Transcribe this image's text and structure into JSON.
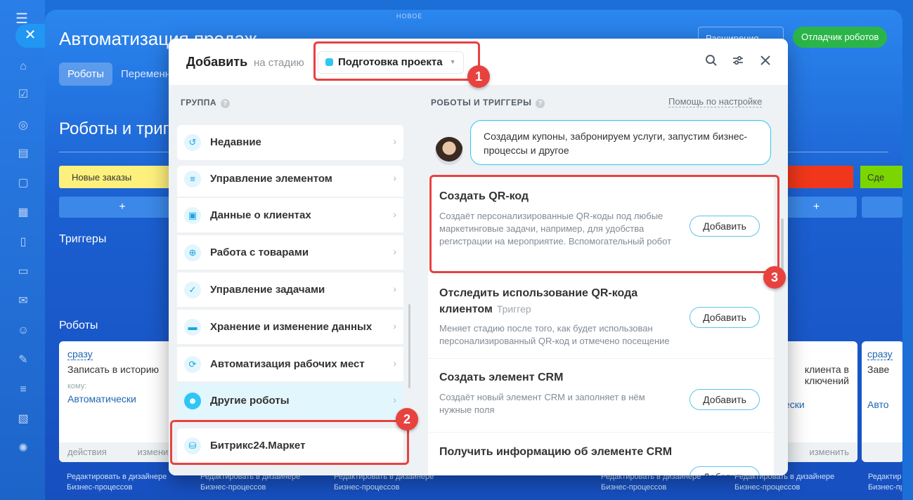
{
  "rail": {
    "icons": [
      "menu-icon",
      "close-icon",
      "home-icon",
      "check-icon",
      "palette-icon",
      "doc-icon",
      "chat-icon",
      "calendar-icon",
      "file-icon",
      "card-icon",
      "mail-icon",
      "users-icon",
      "pen-icon",
      "filter-icon",
      "gear-doc-icon",
      "settings-icon"
    ]
  },
  "background": {
    "top_label": "НОВОЕ",
    "title": "Автоматизация продаж",
    "tabs": [
      "Роботы",
      "Переменные"
    ],
    "extensions_button": "Расширения",
    "debug_button": "Отладчик роботов",
    "section_title": "Роботы и триггеры",
    "stage_new_orders": "Новые заказы",
    "stage_right": "Сде",
    "plus": "+",
    "triggers_label": "Триггеры",
    "robots_label": "Роботы",
    "card_left": {
      "when": "сразу",
      "title": "Записать в историю",
      "to_label": "кому:",
      "to_value": "Автоматически",
      "foot_left": "действия",
      "foot_right": "изменить"
    },
    "card_right": {
      "title_line1": "клиента в",
      "title_line2": "ключений",
      "value": "ески",
      "foot_right": "изменить"
    },
    "card_far": {
      "when": "сразу",
      "title": "Заве",
      "value": "Авто"
    },
    "edit_link_line1": "Редактировать в дизайнере",
    "edit_link_line2": "Бизнес-процессов"
  },
  "modal": {
    "title": "Добавить",
    "stage_label": "на стадию",
    "stage_value": "Подготовка проекта",
    "group_caption": "ГРУППА",
    "robots_caption": "РОБОТЫ И ТРИГГЕРЫ",
    "help_link": "Помощь по настройке",
    "groups": [
      {
        "label": "Недавние",
        "icon": "clock-icon"
      },
      {
        "label": "Управление элементом",
        "icon": "filter-icon"
      },
      {
        "label": "Данные о клиентах",
        "icon": "contact-card-icon"
      },
      {
        "label": "Работа с товарами",
        "icon": "cart-icon"
      },
      {
        "label": "Управление задачами",
        "icon": "task-check-icon"
      },
      {
        "label": "Хранение и изменение данных",
        "icon": "database-icon"
      },
      {
        "label": "Автоматизация рабочих мест",
        "icon": "cycle-icon"
      },
      {
        "label": "Другие роботы",
        "icon": "robot-icon"
      },
      {
        "label": "Битрикс24.Маркет",
        "icon": "market-bag-icon"
      }
    ],
    "chat_text": "Создадим купоны, забронируем услуги, запустим бизнес-процессы и другое",
    "robots": [
      {
        "title": "Создать QR-код",
        "desc": "Создаёт персонализированные QR-коды под любые маркетинговые задачи, например, для удобства регистрации на мероприятие. Вспомогательный робот",
        "button": "Добавить"
      },
      {
        "title": "Отследить использование QR-кода клиентом",
        "tag": "Триггер",
        "desc": "Меняет стадию после того, как будет использован персонализированный QR-код и отмечено посещение",
        "button": "Добавить"
      },
      {
        "title": "Создать элемент CRM",
        "desc": "Создаёт новый элемент CRM и заполняет в нём нужные поля",
        "button": "Добавить"
      },
      {
        "title": "Получить информацию об элементе CRM",
        "button": "Добавить"
      }
    ],
    "badges": [
      "1",
      "2",
      "3"
    ],
    "highlight_color": "#e8423f",
    "accent_color": "#2fc6f6"
  }
}
